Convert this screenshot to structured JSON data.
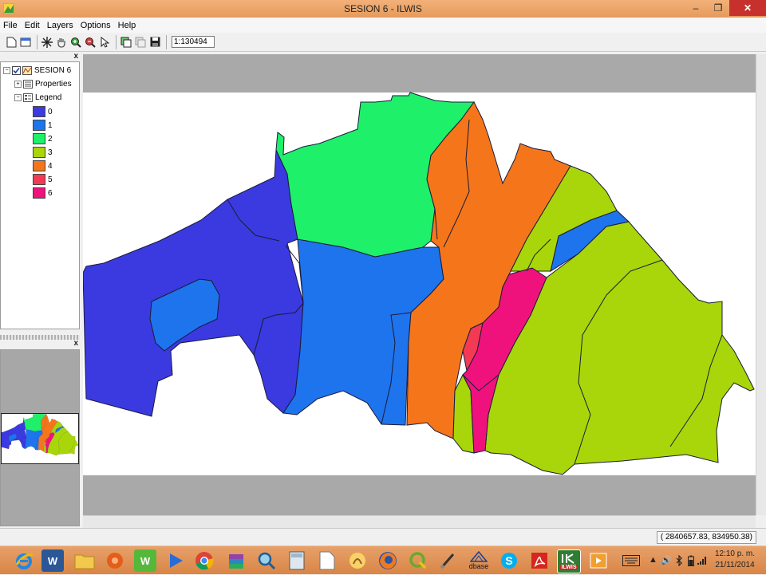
{
  "window": {
    "title": "SESION 6 - ILWIS",
    "controls": {
      "minimize": "–",
      "restore": "❐",
      "close": "✕"
    }
  },
  "menu": [
    "File",
    "Edit",
    "Layers",
    "Options",
    "Help"
  ],
  "toolbar": {
    "scale_value": "1:130494"
  },
  "layer_panel": {
    "close_label": "x",
    "root_label": "SESION 6",
    "properties_label": "Properties",
    "legend_label": "Legend",
    "legend": [
      {
        "label": "0",
        "color": "#3a3ae0"
      },
      {
        "label": "1",
        "color": "#1e74ec"
      },
      {
        "label": "2",
        "color": "#1ef06a"
      },
      {
        "label": "3",
        "color": "#a8d60a"
      },
      {
        "label": "4",
        "color": "#f5761a"
      },
      {
        "label": "5",
        "color": "#f33a55"
      },
      {
        "label": "6",
        "color": "#f0127c"
      }
    ]
  },
  "overview_panel": {
    "close_label": "x"
  },
  "status": {
    "coordinates": "( 2840657.83,  834950.38)"
  },
  "taskbar": {
    "apps": [
      "internet-explorer",
      "word",
      "file-explorer",
      "origin",
      "ilwis-w",
      "media-player",
      "chrome",
      "winrar",
      "magnifier",
      "calculator",
      "notepad",
      "scanner",
      "firefox",
      "qgis",
      "brush-tool",
      "dbase",
      "skype",
      "acrobat",
      "ilwis",
      "video"
    ],
    "dbase_label": "dbase",
    "ilwis_label": "ILWIS",
    "clock_time": "12:10 p. m.",
    "clock_date": "21/11/2014"
  }
}
